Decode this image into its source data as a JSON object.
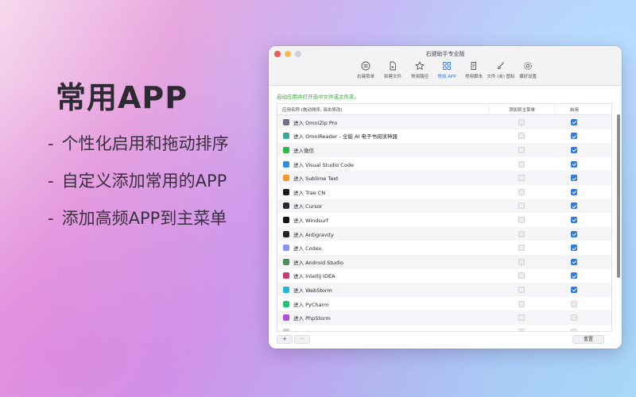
{
  "promo": {
    "title": "常用APP",
    "features": [
      {
        "dash": "-",
        "text": "个性化启用和拖动排序"
      },
      {
        "dash": "-",
        "text": "自定义添加常用的APP"
      },
      {
        "dash": "-",
        "text": "添加高频APP到主菜单"
      }
    ]
  },
  "window": {
    "title": "右键助手专业版",
    "toolbar": [
      {
        "label": "右键菜单",
        "icon": "menu-list-icon"
      },
      {
        "label": "新建文件",
        "icon": "new-file-icon"
      },
      {
        "label": "常用路径",
        "icon": "star-icon"
      },
      {
        "label": "常用 APP",
        "icon": "app-grid-icon",
        "active": true
      },
      {
        "label": "常用脚本",
        "icon": "script-icon"
      },
      {
        "label": "文件 (夹) 图标",
        "icon": "brush-icon"
      },
      {
        "label": "偏好设置",
        "icon": "gear-icon"
      }
    ],
    "hint": "启动应用并打开选中文件或文件夹。",
    "columns": {
      "name": "应用名称 (拖动排序, 双击修改)",
      "add_to_main": "添加到主菜单",
      "enabled": "启用"
    },
    "rows": [
      {
        "name": "进入 OmniZip Pro",
        "icon_color": "#6b6f80",
        "enabled": true
      },
      {
        "name": "进入 OmniReader - 全能 AI 电子书阅读神器",
        "icon_color": "#3aa8a0",
        "enabled": true
      },
      {
        "name": "进入微信",
        "icon_color": "#33b94a",
        "enabled": true
      },
      {
        "name": "进入 Visual Studio Code",
        "icon_color": "#2f8fe0",
        "enabled": true
      },
      {
        "name": "进入 Sublime Text",
        "icon_color": "#f09a2a",
        "enabled": true
      },
      {
        "name": "进入 Trae CN",
        "icon_color": "#1d1d20",
        "enabled": true
      },
      {
        "name": "进入 Cursor",
        "icon_color": "#2a2a2e",
        "enabled": true
      },
      {
        "name": "进入 Windsurf",
        "icon_color": "#111111",
        "enabled": true
      },
      {
        "name": "进入 Antigravity",
        "icon_color": "#222225",
        "enabled": true
      },
      {
        "name": "进入 Codex",
        "icon_color": "#8b8ff0",
        "enabled": true
      },
      {
        "name": "进入 Android Studio",
        "icon_color": "#4c8c5a",
        "enabled": true
      },
      {
        "name": "进入 IntelliJ IDEA",
        "icon_color": "#d2336c",
        "enabled": true
      },
      {
        "name": "进入 WebStorm",
        "icon_color": "#20b7d6",
        "enabled": true
      },
      {
        "name": "进入 PyCharm",
        "icon_color": "#21c37a",
        "enabled": false
      },
      {
        "name": "进入 PhpStorm",
        "icon_color": "#b34fd8",
        "enabled": false
      },
      {
        "name": "",
        "icon_color": "#cccccc",
        "enabled": false
      }
    ],
    "buttons": {
      "add": "+",
      "remove": "−",
      "reset": "重置"
    }
  },
  "colors": {
    "accent": "#2d7ae4",
    "hint_green": "#3eaa3e"
  }
}
